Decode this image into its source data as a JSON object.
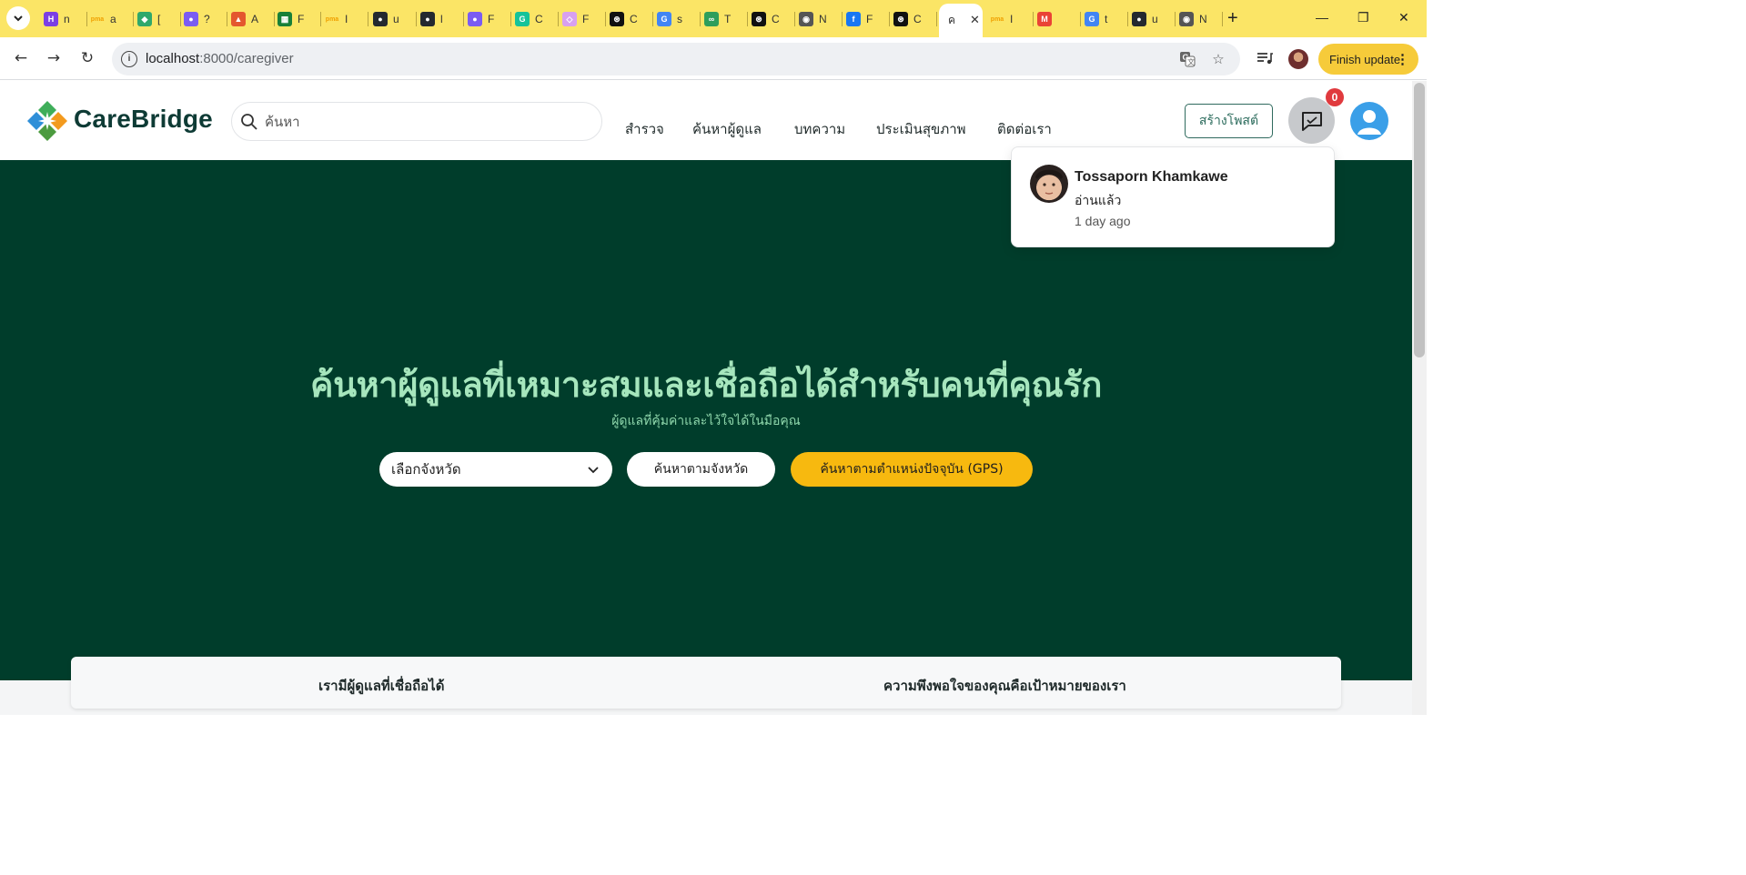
{
  "browser": {
    "tabs": [
      {
        "icon": "hackmd-icon",
        "letter": "n",
        "color": "#7b3fe4",
        "glyph": "H"
      },
      {
        "icon": "pma-icon",
        "letter": "a",
        "color": "#f0a000",
        "glyph": "pma"
      },
      {
        "icon": "diamond-icon",
        "letter": "[",
        "color": "#2fa86b",
        "glyph": "◆"
      },
      {
        "icon": "copilot-icon",
        "letter": "?",
        "color": "#7b5cf2",
        "glyph": "●"
      },
      {
        "icon": "classroom-icon",
        "letter": "A",
        "color": "#e4572e",
        "glyph": "▲"
      },
      {
        "icon": "sheets-icon",
        "letter": "F",
        "color": "#188038",
        "glyph": "▦"
      },
      {
        "icon": "pma-icon",
        "letter": "I",
        "color": "#f0a000",
        "glyph": "pma"
      },
      {
        "icon": "github-icon",
        "letter": "u",
        "color": "#24292f",
        "glyph": "●"
      },
      {
        "icon": "github-icon",
        "letter": "l",
        "color": "#24292f",
        "glyph": "●"
      },
      {
        "icon": "copilot-icon",
        "letter": "F",
        "color": "#7b5cf2",
        "glyph": "●"
      },
      {
        "icon": "grammarly-icon",
        "letter": "C",
        "color": "#15c39a",
        "glyph": "G"
      },
      {
        "icon": "cube-icon",
        "letter": "F",
        "color": "#d8a0f0",
        "glyph": "◇"
      },
      {
        "icon": "chatgpt-icon",
        "letter": "C",
        "color": "#111111",
        "glyph": "⊛"
      },
      {
        "icon": "google-icon",
        "letter": "s",
        "color": "#4285f4",
        "glyph": "G"
      },
      {
        "icon": "infinity-icon",
        "letter": "T",
        "color": "#2e9e5b",
        "glyph": "∞"
      },
      {
        "icon": "chatgpt-icon",
        "letter": "C",
        "color": "#111111",
        "glyph": "⊛"
      },
      {
        "icon": "chrome-icon",
        "letter": "N",
        "color": "#555555",
        "glyph": "◉"
      },
      {
        "icon": "facebook-icon",
        "letter": "F",
        "color": "#1877f2",
        "glyph": "f"
      },
      {
        "icon": "chatgpt-icon",
        "letter": "C",
        "color": "#111111",
        "glyph": "⊛"
      },
      {
        "icon": "pma-icon",
        "letter": "I",
        "color": "#f0a000",
        "glyph": "pma"
      },
      {
        "icon": "gmail-icon",
        "letter": "",
        "color": "#ea4335",
        "glyph": "M"
      },
      {
        "icon": "google-icon",
        "letter": "t",
        "color": "#4285f4",
        "glyph": "G"
      },
      {
        "icon": "github-icon",
        "letter": "u",
        "color": "#24292f",
        "glyph": "●"
      },
      {
        "icon": "chrome-icon",
        "letter": "N",
        "color": "#555555",
        "glyph": "◉"
      }
    ],
    "active_tab_letter": "ค",
    "url_host": "localhost",
    "url_path": ":8000/caregiver",
    "finish_update_label": "Finish update"
  },
  "header": {
    "brand": "CareBridge",
    "search_placeholder": "ค้นหา",
    "nav": [
      "สำรวจ",
      "ค้นหาผู้ดูแล",
      "บทความ",
      "ประเมินสุขภาพ",
      "ติดต่อเรา"
    ],
    "create_post_label": "สร้างโพสต์",
    "message_count": "0"
  },
  "notification": {
    "name": "Tossaporn Khamkawe",
    "message": "อ่านแล้ว",
    "time": "1 day ago"
  },
  "hero": {
    "title": "ค้นหาผู้ดูแลที่เหมาะสมและเชื่อถือได้สำหรับคนที่คุณรัก",
    "subtitle": "ผู้ดูแลที่คุ้มค่าและไว้ใจได้ในมือคุณ",
    "province_select_label": "เลือกจังหวัด",
    "search_province_label": "ค้นหาตามจังหวัด",
    "search_gps_label": "ค้นหาตามตำแหน่งปัจจุบัน (GPS)"
  },
  "features": {
    "left": "เรามีผู้ดูแลที่เชื่อถือได้",
    "right": "ความพึงพอใจของคุณคือเป้าหมายของเรา"
  },
  "colors": {
    "tabstrip": "#fbe566",
    "hero_bg": "#003d2b",
    "hero_text": "#a6e6bd",
    "gps_button": "#f7b90f",
    "badge": "#e03a3e",
    "avatar": "#3a9fe8"
  }
}
